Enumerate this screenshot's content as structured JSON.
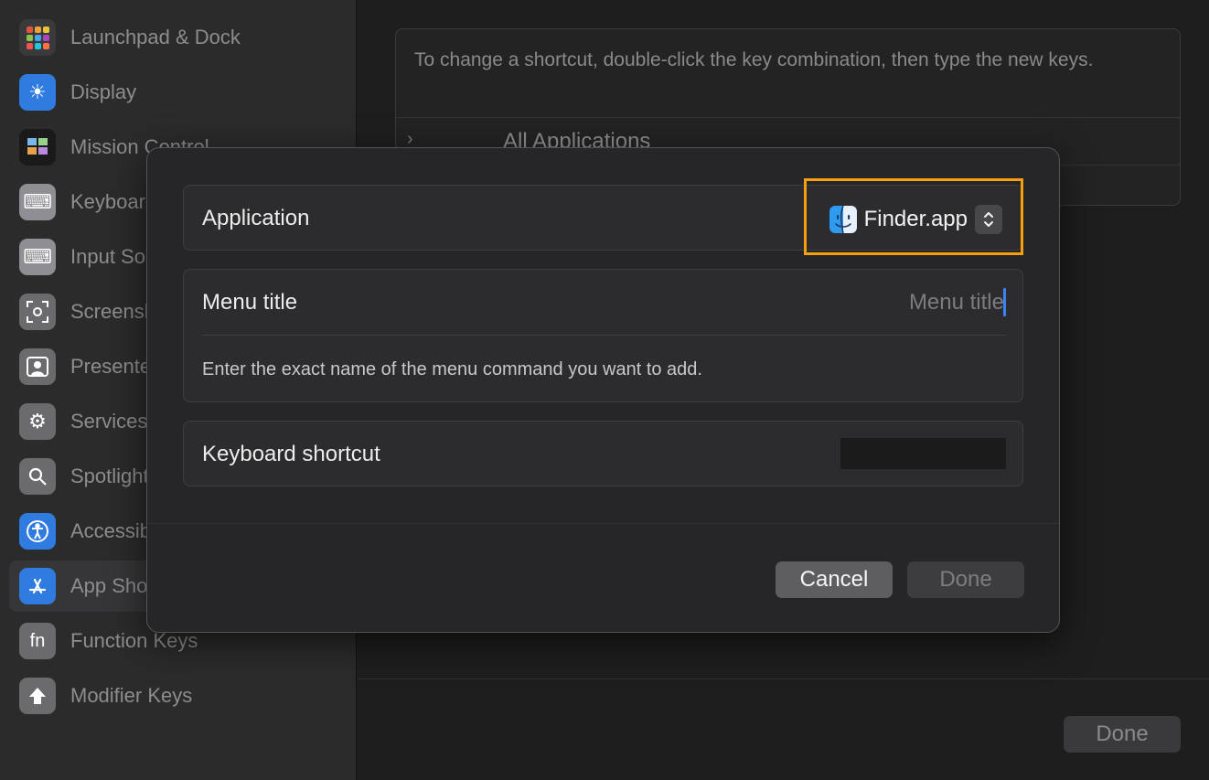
{
  "sidebar": {
    "items": [
      {
        "label": "Launchpad & Dock",
        "icon": "launchpad-icon",
        "color": "#d2543d"
      },
      {
        "label": "Display",
        "icon": "sun-icon",
        "color": "#2f7bdf"
      },
      {
        "label": "Mission Control",
        "icon": "mission-control-icon",
        "color": "#222222"
      },
      {
        "label": "Keyboard",
        "icon": "keyboard-icon",
        "color": "#8e8e93"
      },
      {
        "label": "Input Sources",
        "icon": "keyboard-icon",
        "color": "#8e8e93"
      },
      {
        "label": "Screenshots",
        "icon": "screenshot-icon",
        "color": "#6b6b6e"
      },
      {
        "label": "Presenter Overlay",
        "icon": "person-icon",
        "color": "#6b6b6e"
      },
      {
        "label": "Services",
        "icon": "gears-icon",
        "color": "#6b6b6e"
      },
      {
        "label": "Spotlight",
        "icon": "magnifier-icon",
        "color": "#6b6b6e"
      },
      {
        "label": "Accessibility",
        "icon": "accessibility-icon",
        "color": "#2f7bdf"
      },
      {
        "label": "App Shortcuts",
        "icon": "app-store-icon",
        "color": "#2f7bdf",
        "selected": true
      },
      {
        "label": "Function Keys",
        "icon": "fn-icon",
        "color": "#6b6b6e"
      },
      {
        "label": "Modifier Keys",
        "icon": "up-arrow-icon",
        "color": "#6b6b6e"
      }
    ]
  },
  "main": {
    "info_text": "To change a shortcut, double-click the key combination, then type the new keys.",
    "first_row_label": "All Applications",
    "done_label": "Done"
  },
  "sheet": {
    "application_label": "Application",
    "application_value": "Finder.app",
    "menu_title_label": "Menu title",
    "menu_title_placeholder": "Menu title",
    "menu_title_value": "",
    "help_text": "Enter the exact name of the menu command you want to add.",
    "keyboard_shortcut_label": "Keyboard shortcut",
    "cancel_label": "Cancel",
    "done_label": "Done",
    "highlight_color": "#f5a00c"
  }
}
